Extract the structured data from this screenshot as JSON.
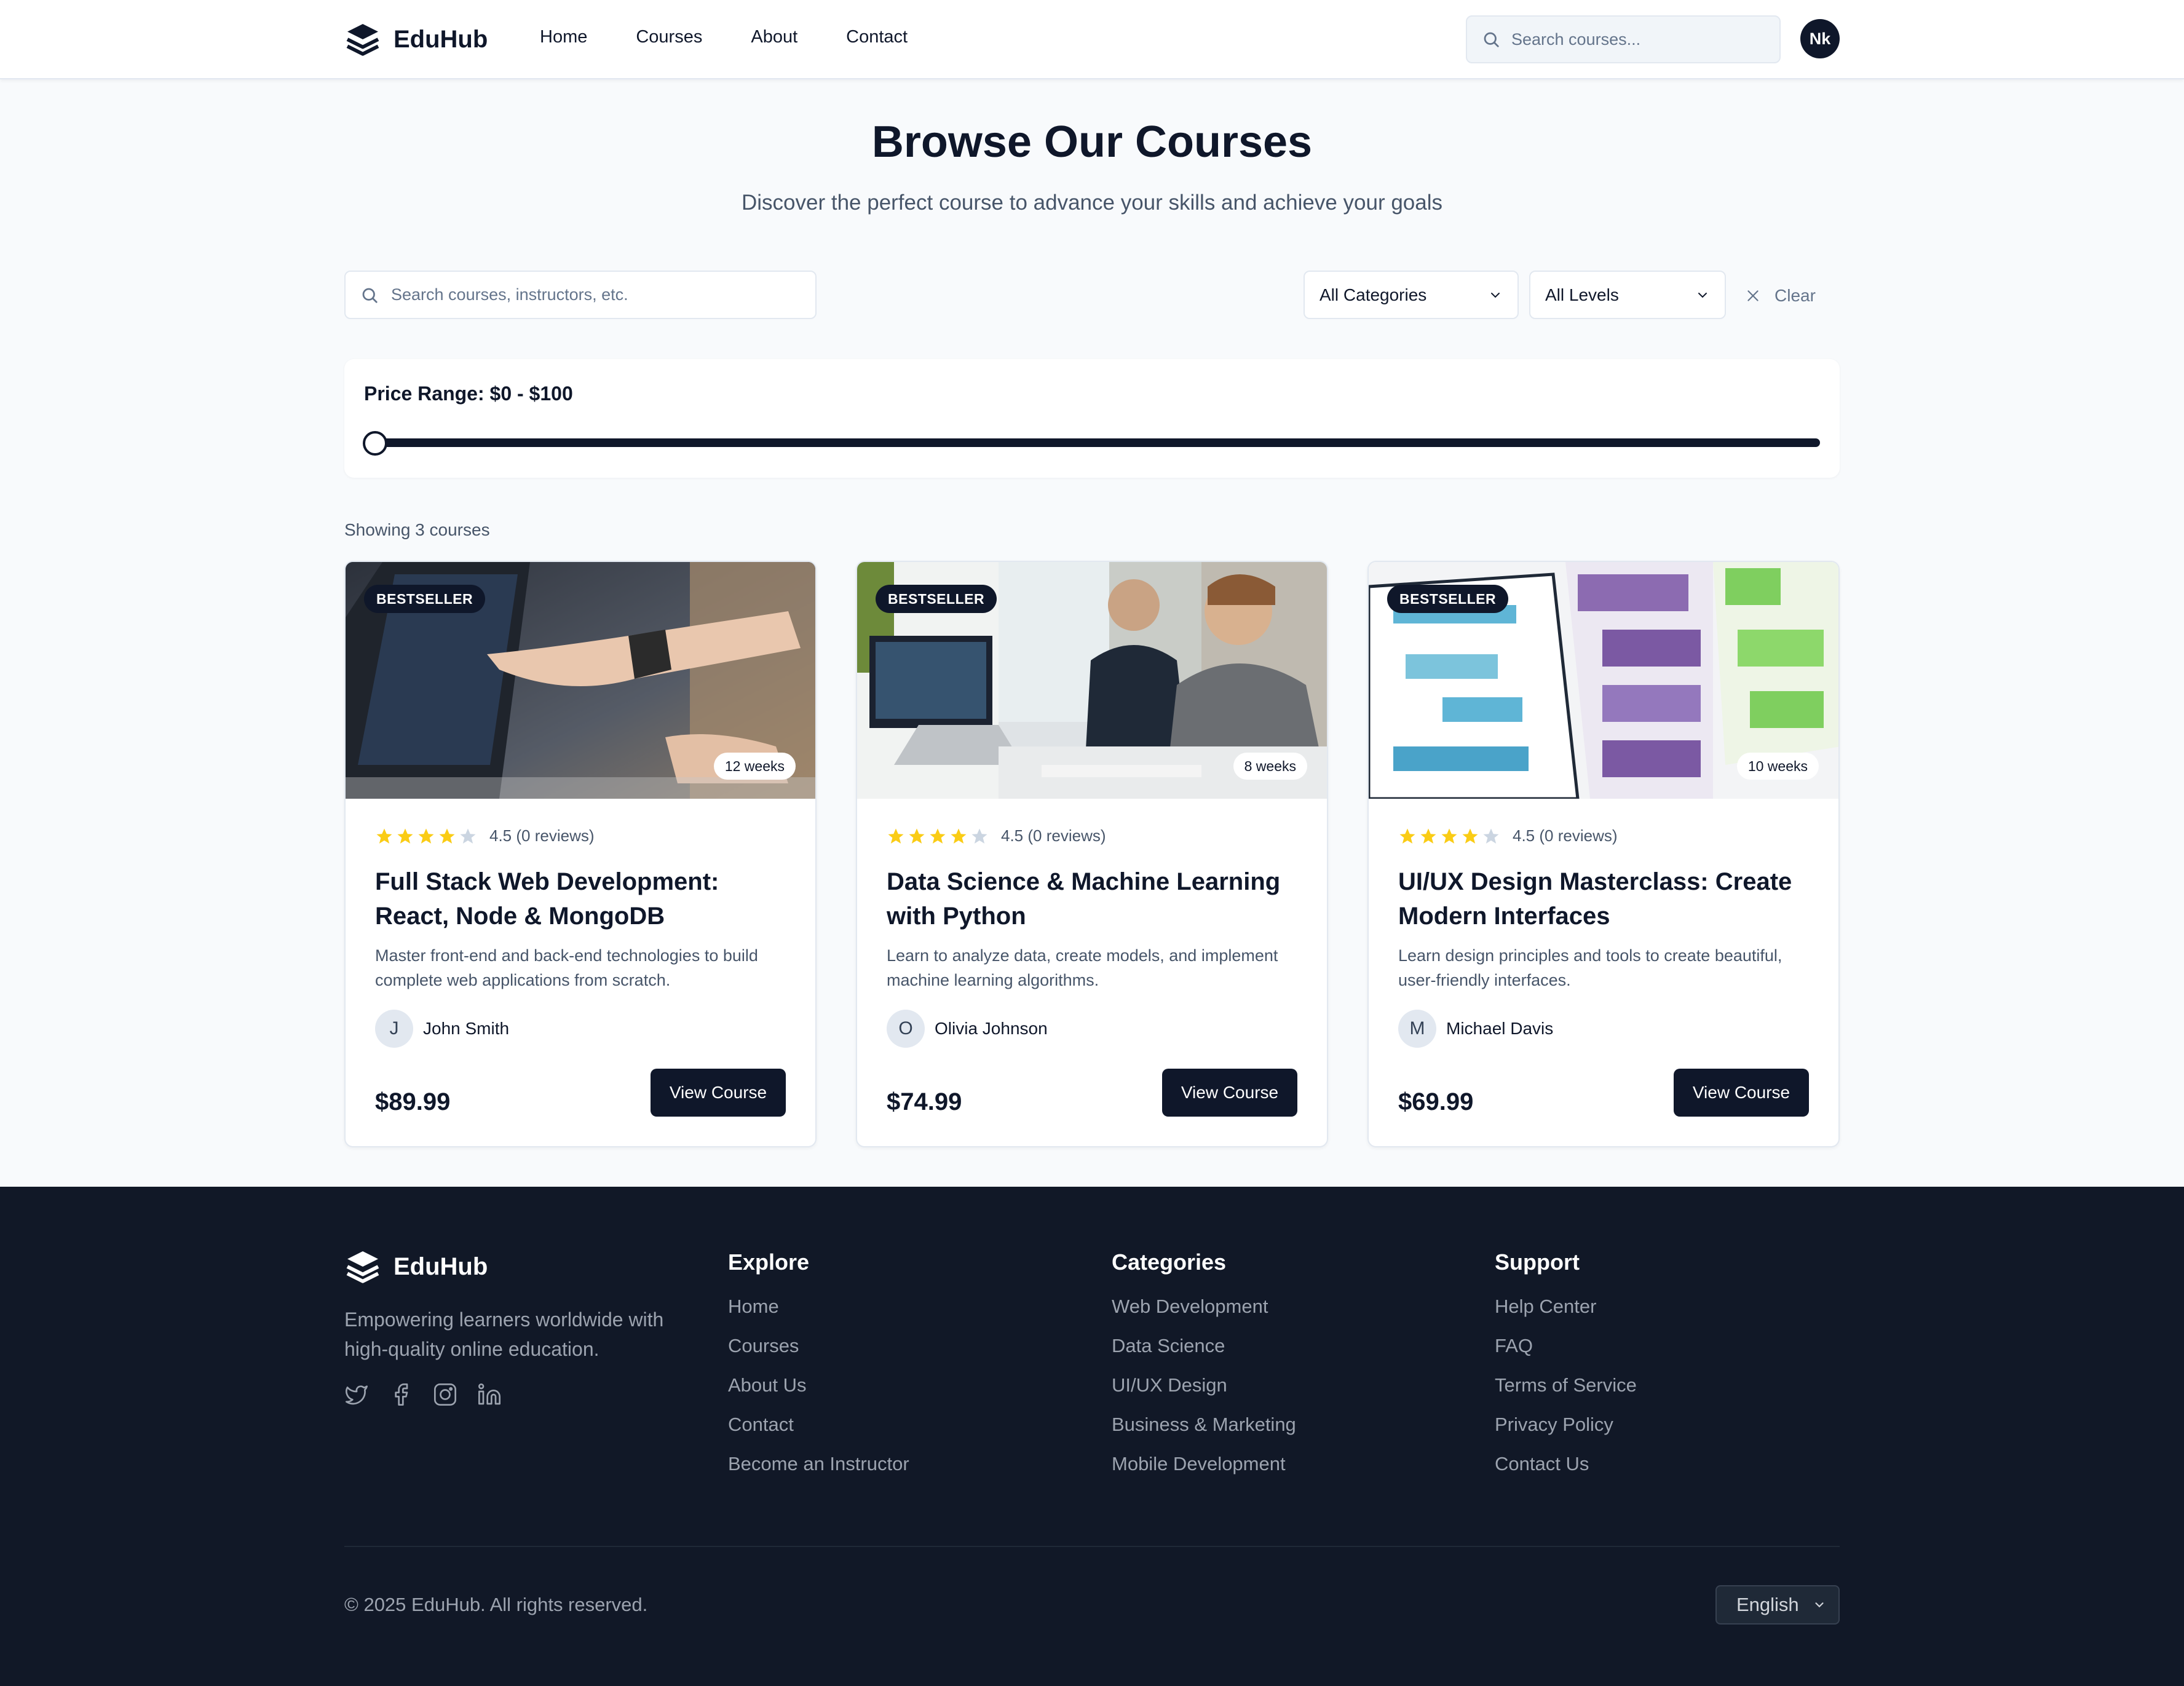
{
  "nav": {
    "brand": "EduHub",
    "links": [
      "Home",
      "Courses",
      "About",
      "Contact"
    ],
    "search_placeholder": "Search courses...",
    "avatar_initials": "Nk"
  },
  "hero": {
    "title": "Browse Our Courses",
    "subtitle": "Discover the perfect course to advance your skills and achieve your goals"
  },
  "filters": {
    "search_placeholder": "Search courses, instructors, etc.",
    "category": "All Categories",
    "level": "All Levels",
    "clear_label": "Clear"
  },
  "price": {
    "label": "Price Range:",
    "range": "$0 - $100",
    "slider_value_fraction": 0
  },
  "results": {
    "showing": "Showing 3 courses"
  },
  "courses": [
    {
      "badge": "BESTSELLER",
      "duration": "12 weeks",
      "rating": 4.5,
      "rating_text": "4.5 (0 reviews)",
      "title": "Full Stack Web Development: React, Node & MongoDB",
      "description": "Master front-end and back-end technologies to build complete web applications from scratch.",
      "instructor_initial": "J",
      "instructor": "John Smith",
      "price": "$89.99",
      "button": "View Course"
    },
    {
      "badge": "BESTSELLER",
      "duration": "8 weeks",
      "rating": 4.5,
      "rating_text": "4.5 (0 reviews)",
      "title": "Data Science & Machine Learning with Python",
      "description": "Learn to analyze data, create models, and implement machine learning algorithms.",
      "instructor_initial": "O",
      "instructor": "Olivia Johnson",
      "price": "$74.99",
      "button": "View Course"
    },
    {
      "badge": "BESTSELLER",
      "duration": "10 weeks",
      "rating": 4.5,
      "rating_text": "4.5 (0 reviews)",
      "title": "UI/UX Design Masterclass: Create Modern Interfaces",
      "description": "Learn design principles and tools to create beautiful, user-friendly interfaces.",
      "instructor_initial": "M",
      "instructor": "Michael Davis",
      "price": "$69.99",
      "button": "View Course"
    }
  ],
  "footer": {
    "brand": "EduHub",
    "tagline": "Empowering learners worldwide with high-quality online education.",
    "socials": [
      "twitter-icon",
      "facebook-icon",
      "instagram-icon",
      "linkedin-icon"
    ],
    "columns": [
      {
        "heading": "Explore",
        "links": [
          "Home",
          "Courses",
          "About Us",
          "Contact",
          "Become an Instructor"
        ]
      },
      {
        "heading": "Categories",
        "links": [
          "Web Development",
          "Data Science",
          "UI/UX Design",
          "Business & Marketing",
          "Mobile Development"
        ]
      },
      {
        "heading": "Support",
        "links": [
          "Help Center",
          "FAQ",
          "Terms of Service",
          "Privacy Policy",
          "Contact Us"
        ]
      }
    ],
    "copyright": "© 2025 EduHub. All rights reserved.",
    "language": "English"
  },
  "colors": {
    "primary": "#0f172a",
    "star": "#facc15",
    "star_empty": "#cbd5e1",
    "footer_bg": "#111827",
    "page_bg": "#f8fafc"
  }
}
